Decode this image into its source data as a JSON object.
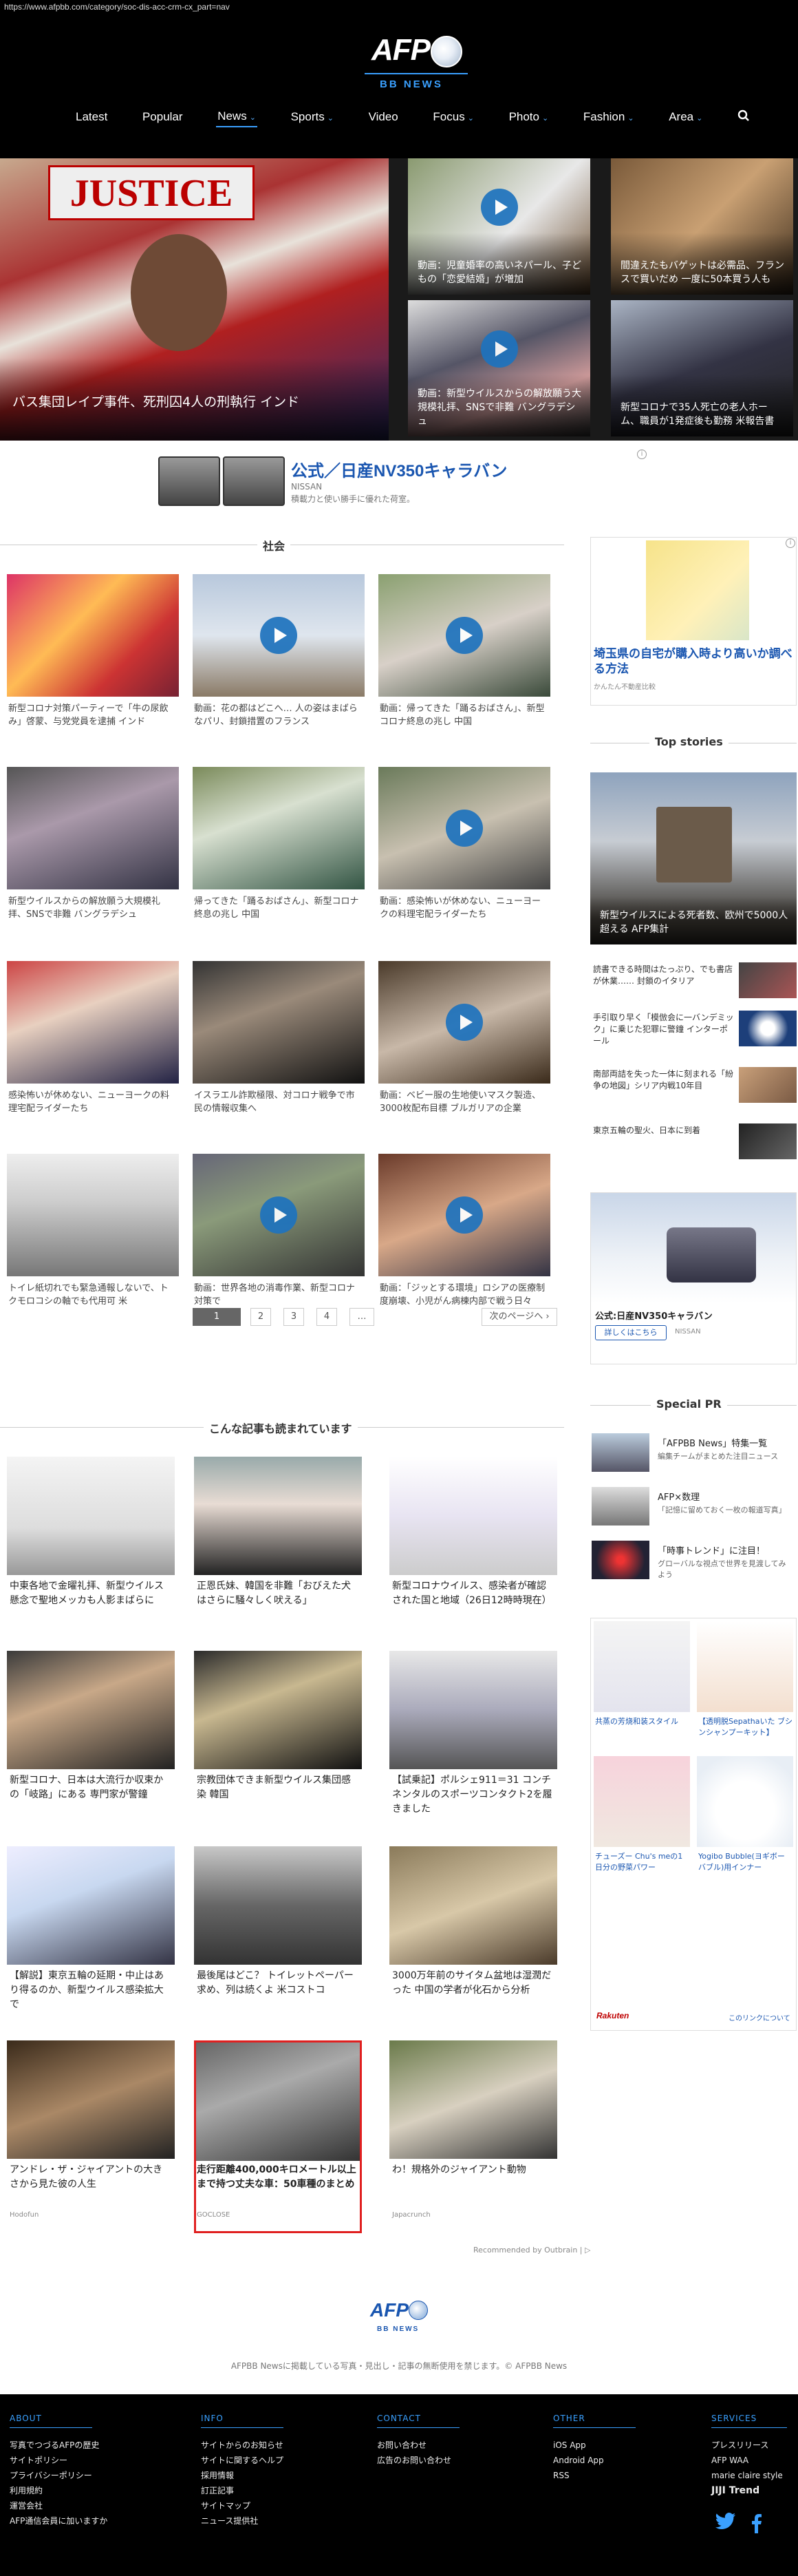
{
  "url": "https://www.afpbb.com/category/soc-dis-acc-crm-cx_part=nav",
  "brand": {
    "logo": "AFP",
    "sub": "BB NEWS"
  },
  "nav": [
    {
      "label": "Latest",
      "chev": ""
    },
    {
      "label": "Popular",
      "chev": ""
    },
    {
      "label": "News",
      "chev": "⌄"
    },
    {
      "label": "Sports",
      "chev": "⌄"
    },
    {
      "label": "Video",
      "chev": ""
    },
    {
      "label": "Focus",
      "chev": "⌄"
    },
    {
      "label": "Photo",
      "chev": "⌄"
    },
    {
      "label": "Fashion",
      "chev": "⌄"
    },
    {
      "label": "Area",
      "chev": "⌄"
    }
  ],
  "hero": {
    "main": {
      "sign": "JUSTICE",
      "caption": "バス集団レイプ事件、死刑囚4人の刑執行 インド"
    },
    "items": [
      {
        "caption": "動画：児童婚率の高いネパール、子どもの「恋愛結婚」が増加",
        "video": true
      },
      {
        "caption": "間違えたもバゲットは必需品、フランスで買いだめ 一度に50本買う人も",
        "video": false
      },
      {
        "caption": "動画：新型ウイルスからの解放願う大規模礼拝、SNSで非難 バングラデシュ",
        "video": true
      },
      {
        "caption": "新型コロナで35人死亡の老人ホーム、職員が1発症後も勤務 米報告書",
        "video": false
      }
    ]
  },
  "ad_top": {
    "title": "公式／日産NV350キャラバン",
    "brand": "NISSAN",
    "desc": "積載力と使い勝手に優れた荷室。",
    "info": "i"
  },
  "section_social": "社会",
  "grid": [
    {
      "caption": "新型コロナ対策パーティーで「牛の尿飲み」啓蒙、与党党員を逮捕 インド",
      "video": false
    },
    {
      "caption": "動画：花の都はどこへ… 人の姿はまばらなパリ、封鎖措置のフランス",
      "video": true
    },
    {
      "caption": "動画：帰ってきた「踊るおばさん」、新型コロナ終息の兆し 中国",
      "video": true
    },
    {
      "caption": "新型ウイルスからの解放願う大規模礼拝、SNSで非難 バングラデシュ",
      "video": false
    },
    {
      "caption": "帰ってきた「踊るおばさん」、新型コロナ終息の兆し 中国",
      "video": false
    },
    {
      "caption": "動画：感染怖いが休めない、ニューヨークの料理宅配ライダーたち",
      "video": true
    },
    {
      "caption": "感染怖いが休めない、ニューヨークの料理宅配ライダーたち",
      "video": false
    },
    {
      "caption": "イスラエル詐欺極限、対コロナ戦争で市民の情報収集へ",
      "video": false
    },
    {
      "caption": "動画：ベビー服の生地使いマスク製造、3000枚配布目標 ブルガリアの企業",
      "video": true
    },
    {
      "caption": "トイレ紙切れでも緊急通報しないで、トクモロコシの軸でも代用可 米",
      "video": false
    },
    {
      "caption": "動画：世界各地の消毒作業、新型コロナ対策で",
      "video": true
    },
    {
      "caption": "動画：「ジッとする環境」ロシアの医療制度崩壊、小児がん病棟内部で戦う日々",
      "video": true
    }
  ],
  "pager": {
    "pages": [
      "1",
      "2",
      "3",
      "4",
      "…"
    ],
    "next": "次のページへ ›"
  },
  "section_more": "こんな記事も読まれています",
  "more": [
    {
      "caption": "中東各地で金曜礼拝、新型ウイルス懸念で聖地メッカも人影まばらに",
      "source": ""
    },
    {
      "caption": "正恩氏妹、韓国を非難「おびえた犬はさらに騒々しく吠える」",
      "source": ""
    },
    {
      "caption": "新型コロナウイルス、感染者が確認された国と地域（26日12時時現在）",
      "source": ""
    },
    {
      "caption": "新型コロナ、日本は大流行か収束かの「岐路」にある 専門家が警鐘",
      "source": ""
    },
    {
      "caption": "宗教団体できま新型ウイルス集団感染 韓国",
      "source": ""
    },
    {
      "caption": "【試乗記】ポルシェ911＝31 コンチネンタルのスポーツコンタクト2を履きました",
      "source": ""
    },
    {
      "caption": "【解説】東京五輪の延期・中止はあり得るのか、新型ウイルス感染拡大で",
      "source": ""
    },
    {
      "caption": "最後尾はどこ？ トイレットペーパー求め、列は続くよ 米コストコ",
      "source": ""
    },
    {
      "caption": "3000万年前のサイタム盆地は湿潤だった 中国の学者が化石から分析",
      "source": ""
    },
    {
      "caption": "アンドレ・ザ・ジャイアントの大きさから見た彼の人生",
      "source": "Hodofun"
    },
    {
      "caption": "走行距離400,000キロメートル以上まで持つ丈夫な車：50車種のまとめ",
      "source": "GOCLOSE"
    },
    {
      "caption": "わ！規格外のジャイアント動物",
      "source": "Japacrunch"
    }
  ],
  "outbrain": "Recommended by  Outbrain | ▷",
  "side_ad1": {
    "title": "埼玉県の自宅が購入時より高いか調べる方法",
    "source": "かんたん不動産比較"
  },
  "top_stories": {
    "title": "Top stories",
    "main": "新型ウイルスによる死者数、欧州で5000人超える AFP集計",
    "items": [
      "読書できる時間はたっぷり、でも書店が休業…… 封鎖のイタリア",
      "手引取り早く「模倣会に一バンデミック」に乗じた犯罪に警鐘 インターポール",
      "南部両詰を失った一体に刻まれる「紛争の地図」シリア内戦10年目",
      "東京五輪の聖火、日本に到着"
    ]
  },
  "side_ad2": {
    "title": "公式:日産NV350キャラバン",
    "btn": "詳しくはこちら",
    "brand": "NISSAN"
  },
  "special_pr": {
    "title": "Special PR",
    "items": [
      {
        "t1": "「AFPBB News」特集一覧",
        "t2": "編集チームがまとめた注目ニュース"
      },
      {
        "t1": "AFP×数理",
        "t2": "「記憶に留めておく一枚の報道写真」"
      },
      {
        "t1": "「時事トレンド」に注目！",
        "t2": "グローバルな視点で世界を見渡してみよう"
      }
    ]
  },
  "rakuten": {
    "items": [
      {
        "tx": "共蒸の芳烧和装スタイル"
      },
      {
        "tx": "【透明脱Sepathaいた ブシンシャンプーキット】"
      },
      {
        "tx": "チューズー Chu's meの1日分の野菜パワー"
      },
      {
        "tx": "Yogibo Bubble(ヨギボー バブル)用インナー"
      }
    ],
    "logo": "Rakuten",
    "link": "このリンクについて"
  },
  "copyright": "AFPBB Newsに掲載している写真・見出し・記事の無断使用を禁じます。© AFPBB News",
  "footer": [
    {
      "h": "ABOUT",
      "links": [
        "写真でつづるAFPの歴史",
        "サイトポリシー",
        "プライバシーポリシー",
        "利用規約",
        "運営会社",
        "AFP通信会員に加いますか"
      ]
    },
    {
      "h": "INFO",
      "links": [
        "サイトからのお知らせ",
        "サイトに関するヘルプ",
        "採用情報",
        "訂正記事",
        "サイトマップ",
        "ニュース提供社"
      ]
    },
    {
      "h": "CONTACT",
      "links": [
        "お問い合わせ",
        "広告のお問い合わせ"
      ]
    },
    {
      "h": "OTHER",
      "links": [
        "iOS App",
        "Android App",
        "RSS"
      ]
    },
    {
      "h": "SERVICES",
      "links": [
        "プレスリリース",
        "AFP WAA",
        "marie claire style",
        "JIJI Trend"
      ]
    }
  ],
  "colors": {
    "accent": "#3aa0ff",
    "header_bg": "#000000",
    "link": "#1a56b0",
    "highlight": "#e02020"
  }
}
